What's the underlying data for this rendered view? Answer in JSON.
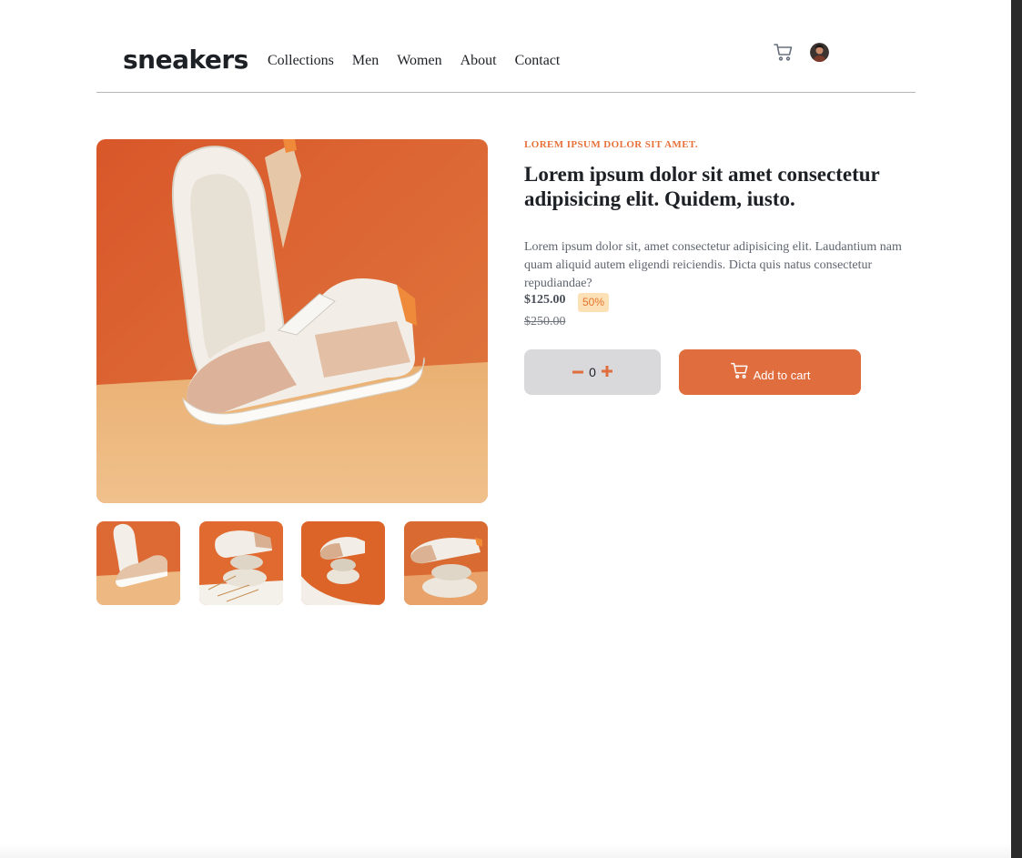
{
  "header": {
    "logo": "sneakers",
    "nav": [
      "Collections",
      "Men",
      "Women",
      "About",
      "Contact"
    ],
    "icons": [
      "cart-icon",
      "avatar"
    ]
  },
  "gallery": {
    "main_image": "white and tan sneaker on orange background",
    "thumbnails": [
      "shoe-1",
      "shoe-2",
      "shoe-3",
      "shoe-4"
    ]
  },
  "product": {
    "brand": "LOREM IPSUM DOLOR SIT AMET.",
    "title": "Lorem ipsum dolor sit amet consectetur adipisicing elit. Quidem, iusto.",
    "description": "Lorem ipsum dolor sit, amet consectetur adipisicing elit. Laudantium nam quam aliquid autem eligendi reiciendis. Dicta quis natus consectetur repudiandae?",
    "price": "$125.00",
    "discount": "50%",
    "old_price": "$250.00",
    "quantity": "0",
    "add_to_cart_label": "Add to cart"
  },
  "colors": {
    "accent": "#e06d3d",
    "discount_bg": "#fde1b6",
    "quantity_bg": "#d9d9dc"
  }
}
